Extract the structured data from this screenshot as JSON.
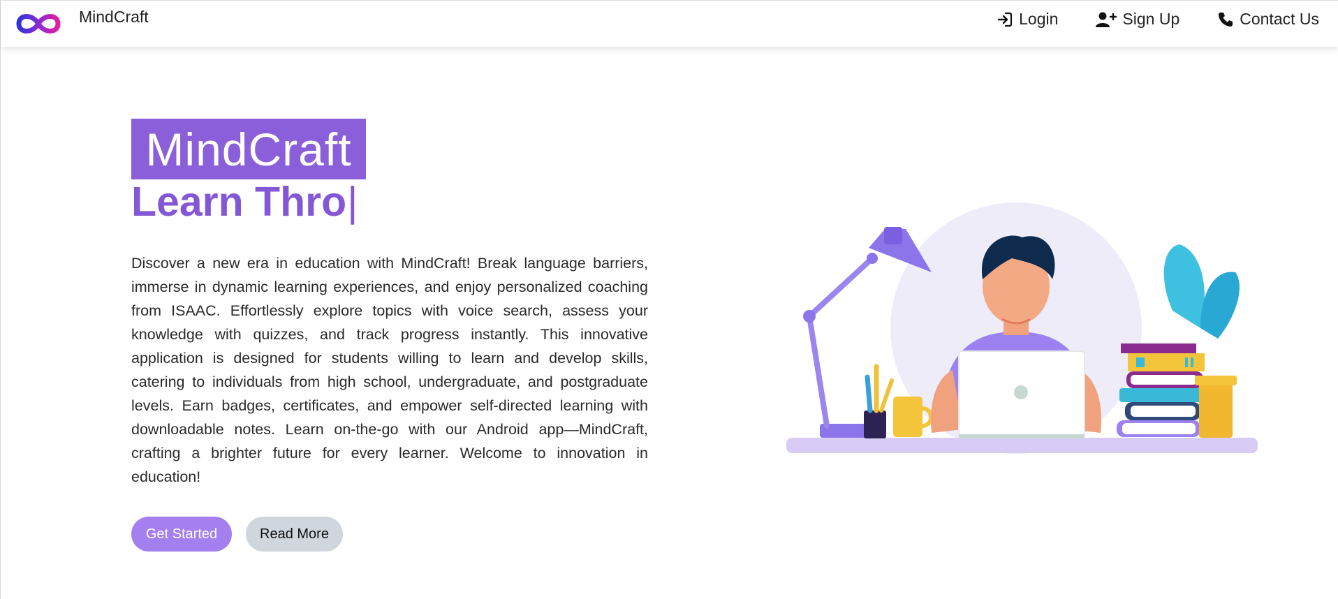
{
  "brand": {
    "name": "MindCraft",
    "logo_icon": "infinity-logo-icon"
  },
  "nav": {
    "login": "Login",
    "signup": "Sign Up",
    "contact": "Contact Us"
  },
  "hero": {
    "badge": "MindCraft",
    "typed_text": "Learn Thro",
    "cursor": "|",
    "description": "Discover a new era in education with MindCraft! Break language barriers, immerse in dynamic learning experiences, and enjoy personalized coaching from ISAAC. Effortlessly explore topics with voice search, assess your knowledge with quizzes, and track progress instantly. This innovative application is designed for students willing to learn and develop skills, catering to individuals from high school, undergraduate, and postgraduate levels. Earn badges, certificates, and empower self-directed learning with downloadable notes. Learn on-the-go with our Android app—MindCraft, crafting a brighter future for every learner. Welcome to innovation in education!",
    "primary_button": "Get Started",
    "secondary_button": "Read More"
  },
  "colors": {
    "accent": "#8a5fd9",
    "accent_light": "#a47ff0",
    "secondary_button": "#cfd6de"
  },
  "icons": {
    "login": "login-icon",
    "signup": "user-plus-icon",
    "contact": "phone-icon"
  }
}
